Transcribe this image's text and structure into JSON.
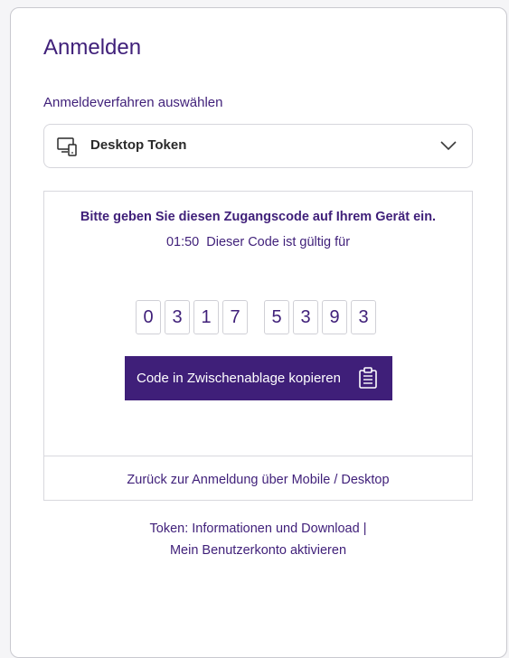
{
  "login": {
    "title": "Anmelden",
    "method_label": "Anmeldeverfahren auswählen",
    "method_select": {
      "icon": "desktop-device-icon",
      "value": "Desktop Token"
    },
    "code_panel": {
      "instruction": "Bitte geben Sie diesen Zugangscode auf Ihrem Gerät ein.",
      "timer": "01:50",
      "validity_text": "Dieser Code ist gültig für",
      "digits": [
        "0",
        "3",
        "1",
        "7",
        "5",
        "3",
        "9",
        "3"
      ],
      "copy_button_label": "Code in Zwischenablage kopieren",
      "copy_icon": "clipboard-icon",
      "back_link": "Zurück zur Anmeldung über Mobile / Desktop"
    },
    "footer": {
      "token_info_link": "Token: Informationen und Download",
      "separator": "|",
      "activate_account_link": "Mein Benutzerkonto aktivieren"
    }
  },
  "colors": {
    "brand": "#3f1f79",
    "border": "#d8d8de",
    "background": "#ffffff"
  }
}
